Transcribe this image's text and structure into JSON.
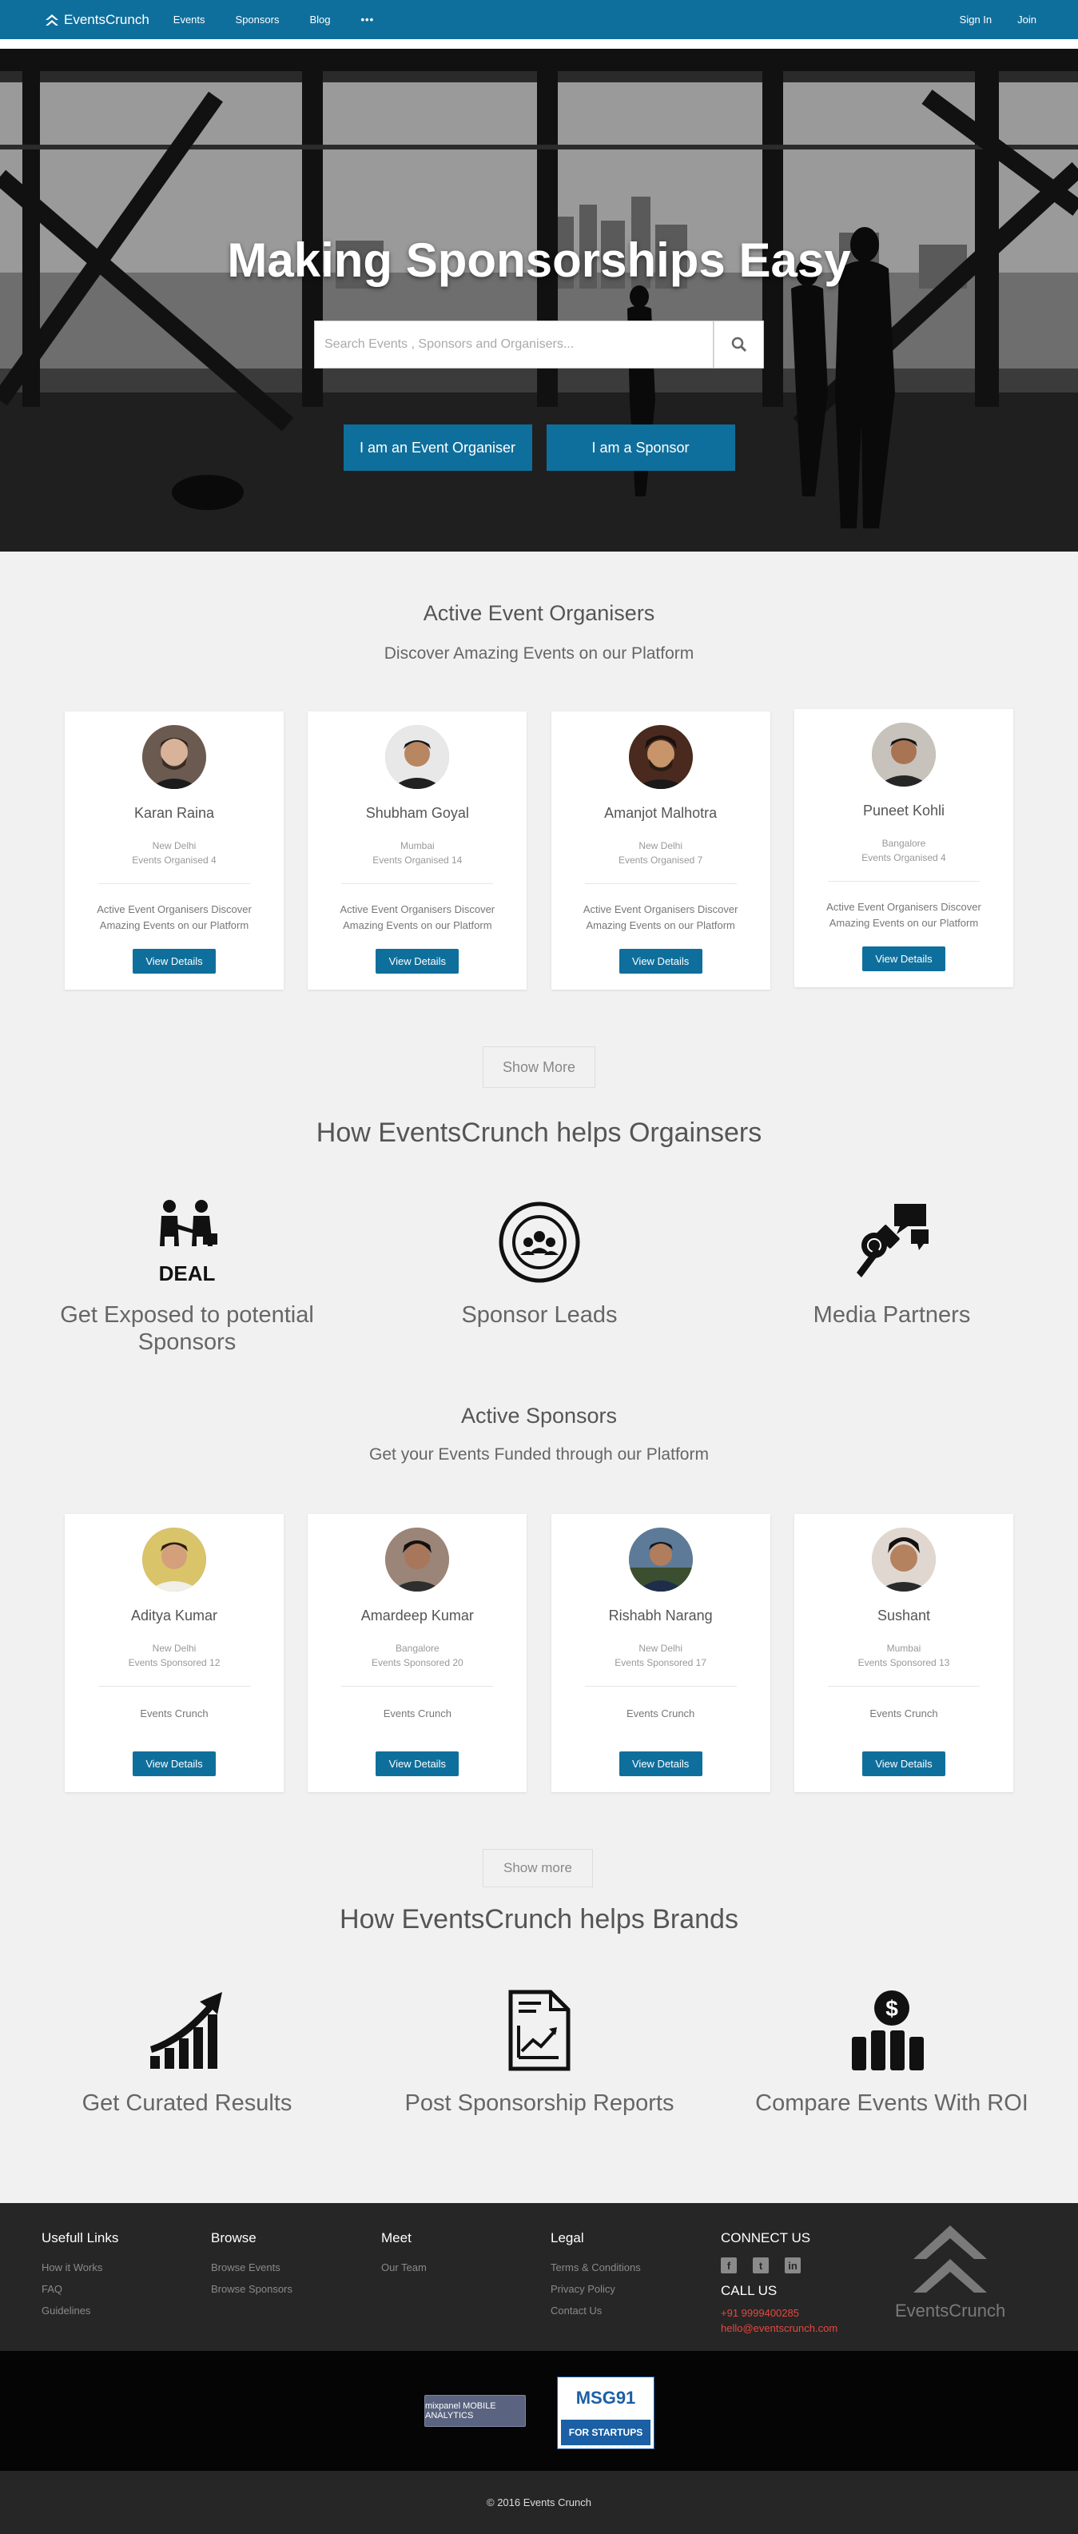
{
  "nav": {
    "brand": "EventsCrunch",
    "links": [
      "Events",
      "Sponsors",
      "Blog",
      "•••"
    ],
    "signin": "Sign In",
    "join": "Join"
  },
  "hero": {
    "title": "Making Sponsorships Easy",
    "search_placeholder": "Search Events , Sponsors and Organisers...",
    "btn_organiser": "I am an Event Organiser",
    "btn_sponsor": "I am a Sponsor"
  },
  "organisers": {
    "title": "Active Event Organisers",
    "subtitle": "Discover Amazing Events on our Platform",
    "cards": [
      {
        "name": "Karan Raina",
        "location": "New Delhi",
        "count": "Events Organised 4",
        "desc": "Active Event Organisers Discover Amazing Events on our Platform",
        "button": "View Details"
      },
      {
        "name": "Shubham Goyal",
        "location": "Mumbai",
        "count": "Events Organised 14",
        "desc": "Active Event Organisers Discover Amazing Events on our Platform",
        "button": "View Details"
      },
      {
        "name": "Amanjot Malhotra",
        "location": "New Delhi",
        "count": "Events Organised 7",
        "desc": "Active Event Organisers Discover Amazing Events on our Platform",
        "button": "View Details"
      },
      {
        "name": "Puneet Kohli",
        "location": "Bangalore",
        "count": "Events Organised 4",
        "desc": "Active Event Organisers Discover Amazing Events on our Platform",
        "button": "View Details"
      }
    ],
    "show_more": "Show More"
  },
  "helps_organisers": {
    "title": "How EventsCrunch helps Orgainsers",
    "features": [
      "Get Exposed to potential Sponsors",
      "Sponsor Leads",
      "Media Partners"
    ],
    "deal_text": "DEAL"
  },
  "sponsors": {
    "title": "Active Sponsors",
    "subtitle": "Get your Events Funded through our Platform",
    "cards": [
      {
        "name": "Aditya Kumar",
        "location": "New Delhi",
        "count": "Events Sponsored 12",
        "desc": "Events Crunch",
        "button": "View Details"
      },
      {
        "name": "Amardeep Kumar",
        "location": "Bangalore",
        "count": "Events Sponsored 20",
        "desc": "Events Crunch",
        "button": "View Details"
      },
      {
        "name": "Rishabh Narang",
        "location": "New Delhi",
        "count": "Events Sponsored 17",
        "desc": "Events Crunch",
        "button": "View Details"
      },
      {
        "name": "Sushant",
        "location": "Mumbai",
        "count": "Events Sponsored 13",
        "desc": "Events Crunch",
        "button": "View Details"
      }
    ],
    "show_more": "Show more"
  },
  "helps_brands": {
    "title": "How EventsCrunch helps Brands",
    "features": [
      "Get Curated Results",
      "Post Sponsorship Reports",
      "Compare Events With ROI"
    ]
  },
  "footer": {
    "useful": {
      "title": "Usefull Links",
      "links": [
        "How it Works",
        "FAQ",
        "Guidelines"
      ]
    },
    "browse": {
      "title": "Browse",
      "links": [
        "Browse Events",
        "Browse Sponsors"
      ]
    },
    "meet": {
      "title": "Meet",
      "links": [
        "Our Team"
      ]
    },
    "legal": {
      "title": "Legal",
      "links": [
        "Terms & Conditions",
        "Privacy Policy",
        "Contact Us"
      ]
    },
    "connect": {
      "title": "CONNECT US",
      "call_title": "CALL US",
      "phone": "+91 9999400285",
      "email": "hello@eventscrunch.com"
    },
    "logo_text": "EventsCrunch",
    "mixpanel_text": "mixpanel MOBILE ANALYTICS",
    "msg91_top": "MSG91",
    "msg91_bottom": "FOR STARTUPS",
    "copyright": "© 2016 Events Crunch"
  },
  "colors": {
    "primary": "#0f6f9c",
    "footer_bg": "#262626",
    "accent_red": "#e8473d"
  }
}
